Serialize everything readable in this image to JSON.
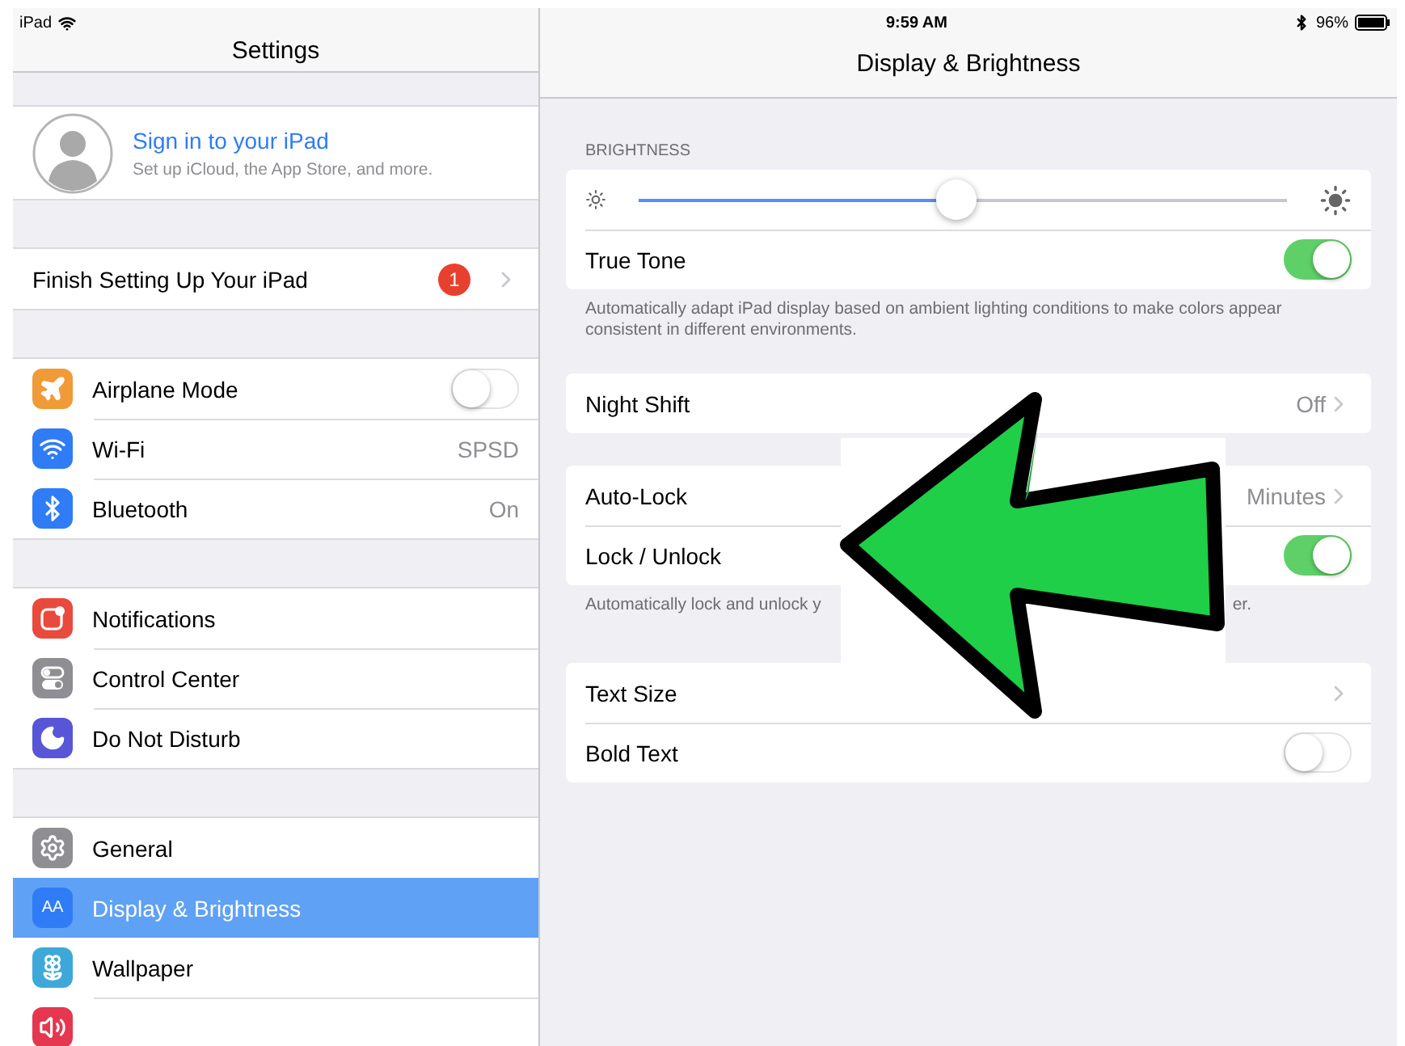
{
  "status_bar": {
    "device": "iPad",
    "time": "9:59 AM",
    "battery": "96%"
  },
  "sidebar": {
    "title": "Settings",
    "profile": {
      "title": "Sign in to your iPad",
      "subtitle": "Set up iCloud, the App Store, and more."
    },
    "groups": [
      [
        {
          "kind": "link",
          "label": "Finish Setting Up Your iPad",
          "badge": "1",
          "selected": false
        }
      ],
      [
        {
          "kind": "toggle",
          "color": "#f19a38",
          "label": "Airplane Mode",
          "on": false,
          "selected": false
        },
        {
          "kind": "link",
          "color": "#2f7cf6",
          "label": "Wi-Fi",
          "value": "SPSD",
          "selected": false
        },
        {
          "kind": "link",
          "color": "#2f7cf6",
          "label": "Bluetooth",
          "value": "On",
          "selected": false
        }
      ],
      [
        {
          "kind": "link",
          "color": "#ea4a3d",
          "label": "Notifications",
          "selected": false
        },
        {
          "kind": "link",
          "color": "#8e8e93",
          "label": "Control Center",
          "selected": false
        },
        {
          "kind": "link",
          "color": "#5856d6",
          "label": "Do Not Disturb",
          "selected": false
        }
      ],
      [
        {
          "kind": "link",
          "color": "#8e8e93",
          "label": "General",
          "selected": false
        },
        {
          "kind": "link",
          "icon_text": "AA",
          "color": "#2f7cf6",
          "label": "Display & Brightness",
          "selected": true
        },
        {
          "kind": "link",
          "color": "#3ea9d9",
          "label": "Wallpaper",
          "selected": false
        },
        {
          "kind": "link",
          "color": "#e5374f",
          "selected": false
        }
      ]
    ]
  },
  "detail": {
    "title": "Display & Brightness",
    "sections": [
      {
        "header": "BRIGHTNESS",
        "rows": [
          {
            "kind": "slider",
            "level": 0.49
          },
          {
            "kind": "toggle",
            "label": "True Tone",
            "on": true
          }
        ],
        "footer": "Automatically adapt iPad display based on ambient lighting conditions to make colors appear consistent in different environments."
      },
      {
        "rows": [
          {
            "kind": "link",
            "label": "Night Shift",
            "value": "Off"
          }
        ]
      },
      {
        "rows": [
          {
            "kind": "link",
            "label": "Auto-Lock",
            "value": "Minutes"
          },
          {
            "kind": "toggle",
            "label": "Lock / Unlock",
            "on": true
          }
        ],
        "footer": "Automatically lock and unlock y",
        "footer_end": "er."
      },
      {
        "rows": [
          {
            "kind": "link",
            "label": "Text Size"
          },
          {
            "kind": "toggle",
            "label": "Bold Text",
            "on": false
          }
        ]
      }
    ]
  }
}
